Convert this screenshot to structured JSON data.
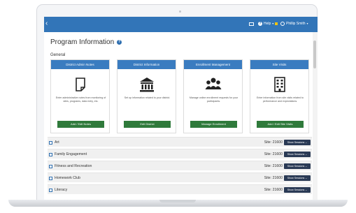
{
  "topbar": {
    "help_label": "Help",
    "user_name": "Phillip Smith"
  },
  "page": {
    "title": "Program Information",
    "section": "General"
  },
  "cards": [
    {
      "title": "District Admin Notes",
      "icon": "note-icon",
      "description": "Enter administrative notes from monitoring of sites, programs, data entry, etc.",
      "button": "Add / Edit Notes"
    },
    {
      "title": "District Information",
      "icon": "building-icon",
      "description": "Set up information related to your district.",
      "button": "Edit District"
    },
    {
      "title": "Enrollment Management",
      "icon": "users-icon",
      "description": "Manage online enrollment requests for your participants.",
      "button": "Manage Enrollment"
    },
    {
      "title": "Site Visits",
      "icon": "building-grid-icon",
      "description": "Enter information from site visits related to performance and expectations.",
      "button": "Add / Edit Site Visits"
    }
  ],
  "programs": [
    {
      "name": "Art",
      "site": "Site: 21600",
      "button": "Show Sessions"
    },
    {
      "name": "Family Engagement",
      "site": "Site: 21600",
      "button": "Show Sessions"
    },
    {
      "name": "Fitness and Recreation",
      "site": "Site: 21600",
      "button": "Show Sessions"
    },
    {
      "name": "Homework Club",
      "site": "Site: 21600",
      "button": "Show Sessions"
    },
    {
      "name": "Literacy",
      "site": "Site: 21600",
      "button": "Show Sessions"
    }
  ],
  "colors": {
    "topbar": "#3275b8",
    "card_header": "#3a7cc0",
    "card_button": "#2f7a3b",
    "sessions_button": "#2a3a55"
  }
}
